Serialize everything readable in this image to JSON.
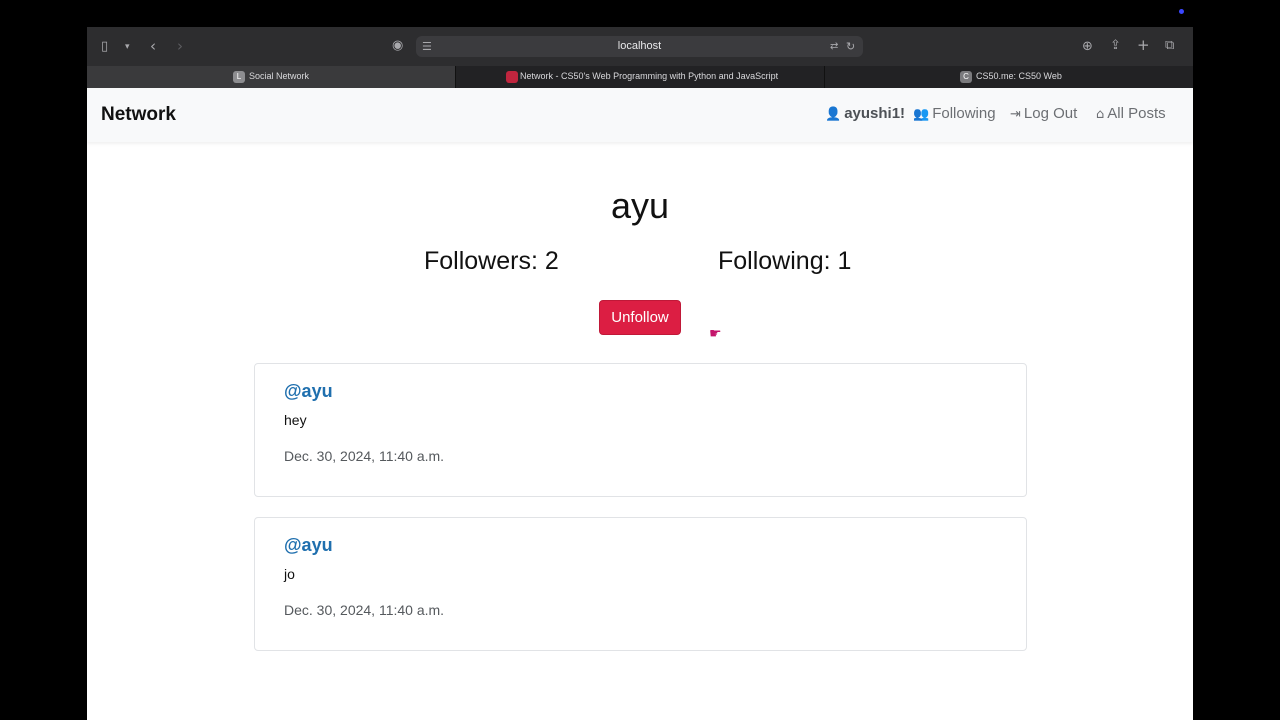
{
  "browser": {
    "url": "localhost",
    "icons": {
      "sidebar": "sidebar-icon",
      "back": "chevron-left-icon",
      "forward": "chevron-right-icon",
      "share": "share-icon",
      "downloads": "download-icon",
      "new_tab": "plus-icon",
      "tabs_overview": "tabs-icon",
      "reload": "reload-icon"
    },
    "tabs": [
      {
        "label": "Social Network",
        "favicon": "L",
        "active": true
      },
      {
        "label": "Network - CS50's Web Programming with Python and JavaScript",
        "favicon": "",
        "active": false
      },
      {
        "label": "CS50.me: CS50 Web",
        "favicon": "C",
        "active": false
      }
    ]
  },
  "nav": {
    "brand": "Network",
    "user": "ayushi1!",
    "following": "Following",
    "logout": "Log Out",
    "all_posts": "All Posts"
  },
  "profile": {
    "username": "ayu",
    "followers": "Followers: 2",
    "following": "Following: 1",
    "button": "Unfollow"
  },
  "posts": [
    {
      "author": "@ayu",
      "body": "hey",
      "timestamp": "Dec. 30, 2024, 11:40 a.m."
    },
    {
      "author": "@ayu",
      "body": "jo",
      "timestamp": "Dec. 30, 2024, 11:40 a.m."
    }
  ],
  "colors": {
    "danger": "#dc1e43",
    "link": "#1f6fae",
    "navbar_bg": "#f8f9fa"
  }
}
